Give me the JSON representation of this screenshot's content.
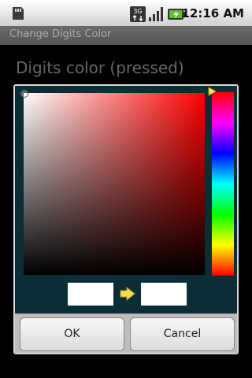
{
  "status_bar": {
    "time": "12:16 AM",
    "icons": [
      "sd-card-icon",
      "network-3g-icon",
      "signal-icon",
      "battery-charging-icon"
    ]
  },
  "title_bar": {
    "title": "Change Digits Color"
  },
  "preference": {
    "title": "Digits color (pressed)"
  },
  "dialog": {
    "picker": {
      "hue_color": "#ff0000",
      "old_color": "#ffffff",
      "new_color": "#ffffff"
    },
    "buttons": {
      "ok": "OK",
      "cancel": "Cancel"
    }
  }
}
